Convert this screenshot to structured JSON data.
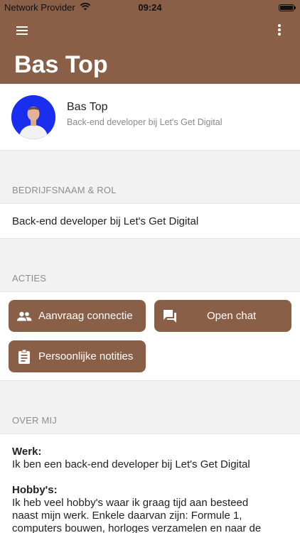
{
  "status_bar": {
    "carrier": "Network Provider",
    "time": "09:24"
  },
  "header": {
    "title": "Bas Top",
    "menu_icon": "hamburger-menu-icon",
    "more_icon": "more-vertical-icon",
    "color": "#8a5f48"
  },
  "profile": {
    "name": "Bas Top",
    "subtitle": "Back-end developer bij Let's Get Digital",
    "avatar_bg": "#1a2ef0"
  },
  "company_section": {
    "label": "BEDRIJFSNAAM & ROL",
    "value": "Back-end developer bij Let's Get Digital"
  },
  "actions_section": {
    "label": "ACTIES",
    "buttons": [
      {
        "label": "Aanvraag connectie",
        "icon": "people-icon"
      },
      {
        "label": "Open chat",
        "icon": "chat-icon"
      },
      {
        "label": "Persoonlijke notities",
        "icon": "clipboard-icon"
      }
    ]
  },
  "about_section": {
    "label": "OVER MIJ",
    "work_heading": "Werk:",
    "work_text": "Ik ben een back-end developer bij Let's Get Digital",
    "hobby_heading": "Hobby's:",
    "hobby_text_1": "Ik heb veel hobby's waar ik graag tijd aan besteed",
    "hobby_text_2": "naast mijn werk. Enkele daarvan zijn: Formule 1,",
    "hobby_text_3": "computers bouwen, horloges verzamelen en naar de"
  }
}
